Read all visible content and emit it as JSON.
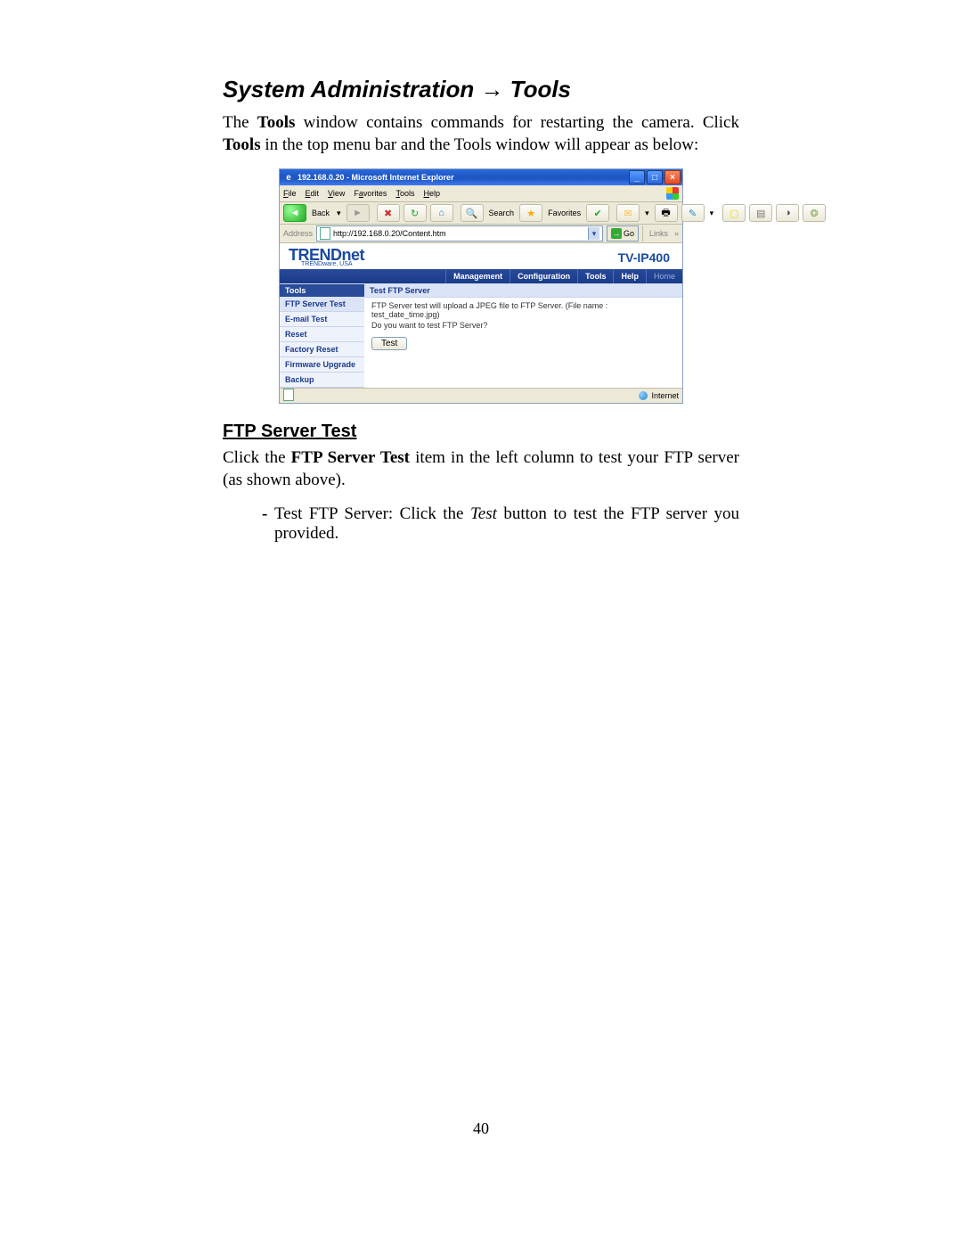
{
  "doc": {
    "section_title": "System Administration → Tools",
    "intro_1a": "The ",
    "intro_1b": "Tools",
    "intro_1c": " window contains commands for restarting the camera. Click ",
    "intro_1d": "Tools",
    "intro_1e": " in the top menu bar and the Tools window will appear as below:",
    "sub_title": "FTP Server Test",
    "p2a": "Click the ",
    "p2b": "FTP Server Test",
    "p2c": " item in the left column to test your FTP server (as shown above).",
    "bullet_dash": "-",
    "b1a": "Test FTP Server:",
    "b1b": " Click the ",
    "b1c": "Test",
    "b1d": " button to test the FTP server you provided.",
    "page_number": "40"
  },
  "ie": {
    "title": "192.168.0.20 - Microsoft Internet Explorer",
    "menus": {
      "file": "File",
      "edit": "Edit",
      "view": "View",
      "favorites": "Favorites",
      "tools": "Tools",
      "help": "Help"
    },
    "toolbar": {
      "back": "Back",
      "search": "Search",
      "favorites": "Favorites"
    },
    "address_label": "Address",
    "address_value": "http://192.168.0.20/Content.htm",
    "go": "Go",
    "links": "Links",
    "status_zone": "Internet"
  },
  "cam": {
    "brand": "TRENDnet",
    "brand_sub": "TRENDware, USA",
    "model": "TV-IP400",
    "tabs": {
      "management": "Management",
      "configuration": "Configuration",
      "tools": "Tools",
      "help": "Help",
      "home": "Home"
    },
    "sidebar": {
      "header": "Tools",
      "items": [
        "FTP Server Test",
        "E-mail Test",
        "Reset",
        "Factory Reset",
        "Firmware Upgrade",
        "Backup"
      ]
    },
    "panel": {
      "header": "Test FTP Server",
      "line1": "FTP Server test will upload a JPEG file to FTP Server. (File name : test_date_time.jpg)",
      "line2": "Do you want to test FTP Server?",
      "button": "Test"
    }
  }
}
